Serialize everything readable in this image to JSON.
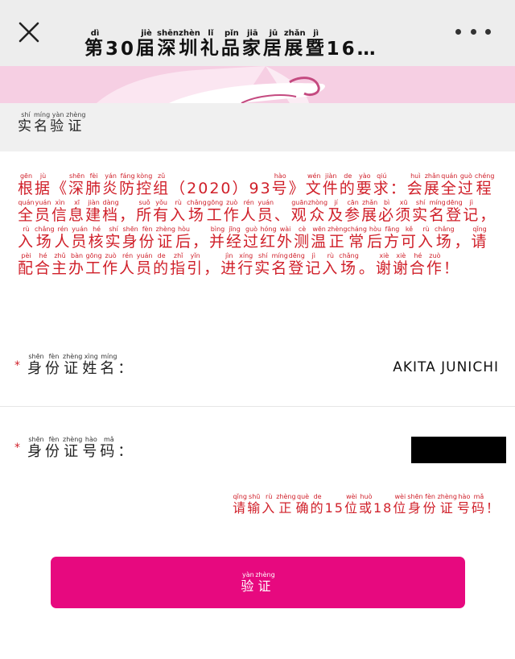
{
  "header": {
    "title_chars": [
      {
        "c": "第",
        "p": "dì"
      },
      {
        "c": "30",
        "p": ""
      },
      {
        "c": "届",
        "p": "jiè"
      },
      {
        "c": "深",
        "p": "shēn"
      },
      {
        "c": "圳",
        "p": "zhèn"
      },
      {
        "c": "礼",
        "p": "lǐ"
      },
      {
        "c": "品",
        "p": "pǐn"
      },
      {
        "c": "家",
        "p": "jiā"
      },
      {
        "c": "居",
        "p": "jū"
      },
      {
        "c": "展",
        "p": "zhǎn"
      },
      {
        "c": "暨",
        "p": "jì"
      },
      {
        "c": "16…",
        "p": ""
      }
    ],
    "close_icon": "close-icon",
    "more_icon": "more-dots-icon"
  },
  "section": {
    "title_chars": [
      {
        "c": "实",
        "p": "shí"
      },
      {
        "c": "名",
        "p": "míng"
      },
      {
        "c": "验",
        "p": "yàn"
      },
      {
        "c": "证",
        "p": "zhèng"
      }
    ]
  },
  "notice": {
    "chars": [
      {
        "c": "根",
        "p": "gēn"
      },
      {
        "c": "据",
        "p": "jù"
      },
      {
        "c": "《",
        "p": ""
      },
      {
        "c": "深",
        "p": "shēn"
      },
      {
        "c": "肺",
        "p": "fèi"
      },
      {
        "c": "炎",
        "p": "yán"
      },
      {
        "c": "防",
        "p": "fáng"
      },
      {
        "c": "控",
        "p": "kòng"
      },
      {
        "c": "组",
        "p": "zǔ"
      },
      {
        "c": "（2020）93",
        "p": ""
      },
      {
        "c": "号",
        "p": "hào"
      },
      {
        "c": "》",
        "p": ""
      },
      {
        "c": "文",
        "p": "wén"
      },
      {
        "c": "件",
        "p": "jiàn"
      },
      {
        "c": "的",
        "p": "de"
      },
      {
        "c": "要",
        "p": "yào"
      },
      {
        "c": "求",
        "p": "qiú"
      },
      {
        "c": "：",
        "p": ""
      },
      {
        "c": "会",
        "p": "huì"
      },
      {
        "c": "展",
        "p": "zhǎn"
      },
      {
        "c": "全",
        "p": "quán"
      },
      {
        "c": "过",
        "p": "guò"
      },
      {
        "c": "程",
        "p": "chéng"
      },
      {
        "c": "全",
        "p": "quán"
      },
      {
        "c": "员",
        "p": "yuán"
      },
      {
        "c": "信",
        "p": "xìn"
      },
      {
        "c": "息",
        "p": "xī"
      },
      {
        "c": "建",
        "p": "jiàn"
      },
      {
        "c": "档",
        "p": "dàng"
      },
      {
        "c": "，",
        "p": ""
      },
      {
        "c": "所",
        "p": "suǒ"
      },
      {
        "c": "有",
        "p": "yǒu"
      },
      {
        "c": "入",
        "p": "rù"
      },
      {
        "c": "场",
        "p": "chǎng"
      },
      {
        "c": "工",
        "p": "gōng"
      },
      {
        "c": "作",
        "p": "zuò"
      },
      {
        "c": "人",
        "p": "rén"
      },
      {
        "c": "员",
        "p": "yuán"
      },
      {
        "c": "、",
        "p": ""
      },
      {
        "c": "观",
        "p": "guān"
      },
      {
        "c": "众",
        "p": "zhòng"
      },
      {
        "c": "及",
        "p": "jí"
      },
      {
        "c": "参",
        "p": "cān"
      },
      {
        "c": "展",
        "p": "zhǎn"
      },
      {
        "c": "必",
        "p": "bì"
      },
      {
        "c": "须",
        "p": "xū"
      },
      {
        "c": "实",
        "p": "shí"
      },
      {
        "c": "名",
        "p": "míng"
      },
      {
        "c": "登",
        "p": "dēng"
      },
      {
        "c": "记",
        "p": "jì"
      },
      {
        "c": "，",
        "p": ""
      },
      {
        "c": "入",
        "p": "rù"
      },
      {
        "c": "场",
        "p": "chǎng"
      },
      {
        "c": "人",
        "p": "rén"
      },
      {
        "c": "员",
        "p": "yuán"
      },
      {
        "c": "核",
        "p": "hé"
      },
      {
        "c": "实",
        "p": "shí"
      },
      {
        "c": "身",
        "p": "shēn"
      },
      {
        "c": "份",
        "p": "fèn"
      },
      {
        "c": "证",
        "p": "zhèng"
      },
      {
        "c": "后",
        "p": "hòu"
      },
      {
        "c": "，",
        "p": ""
      },
      {
        "c": "并",
        "p": "bìng"
      },
      {
        "c": "经",
        "p": "jīng"
      },
      {
        "c": "过",
        "p": "guò"
      },
      {
        "c": "红",
        "p": "hóng"
      },
      {
        "c": "外",
        "p": "wài"
      },
      {
        "c": "测",
        "p": "cè"
      },
      {
        "c": "温",
        "p": "wēn"
      },
      {
        "c": "正",
        "p": "zhèng"
      },
      {
        "c": "常",
        "p": "cháng"
      },
      {
        "c": "后",
        "p": "hòu"
      },
      {
        "c": "方",
        "p": "fāng"
      },
      {
        "c": "可",
        "p": "kě"
      },
      {
        "c": "入",
        "p": "rù"
      },
      {
        "c": "场",
        "p": "chǎng"
      },
      {
        "c": "，",
        "p": ""
      },
      {
        "c": "请",
        "p": "qǐng"
      },
      {
        "c": "配",
        "p": "pèi"
      },
      {
        "c": "合",
        "p": "hé"
      },
      {
        "c": "主",
        "p": "zhǔ"
      },
      {
        "c": "办",
        "p": "bàn"
      },
      {
        "c": "工",
        "p": "gōng"
      },
      {
        "c": "作",
        "p": "zuò"
      },
      {
        "c": "人",
        "p": "rén"
      },
      {
        "c": "员",
        "p": "yuán"
      },
      {
        "c": "的",
        "p": "de"
      },
      {
        "c": "指",
        "p": "zhǐ"
      },
      {
        "c": "引",
        "p": "yǐn"
      },
      {
        "c": "，",
        "p": ""
      },
      {
        "c": "进",
        "p": "jìn"
      },
      {
        "c": "行",
        "p": "xíng"
      },
      {
        "c": "实",
        "p": "shí"
      },
      {
        "c": "名",
        "p": "míng"
      },
      {
        "c": "登",
        "p": "dēng"
      },
      {
        "c": "记",
        "p": "jì"
      },
      {
        "c": "入",
        "p": "rù"
      },
      {
        "c": "场",
        "p": "chǎng"
      },
      {
        "c": "。",
        "p": ""
      },
      {
        "c": "谢",
        "p": "xiè"
      },
      {
        "c": "谢",
        "p": "xiè"
      },
      {
        "c": "合",
        "p": "hé"
      },
      {
        "c": "作",
        "p": "zuò"
      },
      {
        "c": "！",
        "p": ""
      }
    ]
  },
  "form": {
    "name_label_chars": [
      {
        "c": "身",
        "p": "shēn"
      },
      {
        "c": "份",
        "p": "fèn"
      },
      {
        "c": "证",
        "p": "zhèng"
      },
      {
        "c": "姓",
        "p": "xìng"
      },
      {
        "c": "名",
        "p": "míng"
      },
      {
        "c": "：",
        "p": ""
      }
    ],
    "name_value": "AKITA JUNICHI",
    "id_label_chars": [
      {
        "c": "身",
        "p": "shēn"
      },
      {
        "c": "份",
        "p": "fèn"
      },
      {
        "c": "证",
        "p": "zhèng"
      },
      {
        "c": "号",
        "p": "hào"
      },
      {
        "c": "码",
        "p": "mǎ"
      },
      {
        "c": "：",
        "p": ""
      }
    ],
    "required_mark": "*",
    "id_value": "",
    "hint_chars": [
      {
        "c": "请",
        "p": "qǐng"
      },
      {
        "c": "输",
        "p": "shū"
      },
      {
        "c": "入",
        "p": "rù"
      },
      {
        "c": "正",
        "p": "zhèng"
      },
      {
        "c": "确",
        "p": "què"
      },
      {
        "c": "的",
        "p": "de"
      },
      {
        "c": "15",
        "p": ""
      },
      {
        "c": "位",
        "p": "wèi"
      },
      {
        "c": "或",
        "p": "huò"
      },
      {
        "c": "18",
        "p": ""
      },
      {
        "c": "位",
        "p": "wèi"
      },
      {
        "c": "身",
        "p": "shēn"
      },
      {
        "c": "份",
        "p": "fèn"
      },
      {
        "c": "证",
        "p": "zhèng"
      },
      {
        "c": "号",
        "p": "hào"
      },
      {
        "c": "码",
        "p": "mǎ"
      },
      {
        "c": "！",
        "p": ""
      }
    ]
  },
  "verify_button": {
    "chars": [
      {
        "c": "验",
        "p": "yàn"
      },
      {
        "c": "证",
        "p": "zhèng"
      }
    ]
  },
  "colors": {
    "accent": "#e7097f",
    "warning_text": "#d0202a",
    "banner": "#f6cfe3",
    "topbar": "#ededed"
  }
}
